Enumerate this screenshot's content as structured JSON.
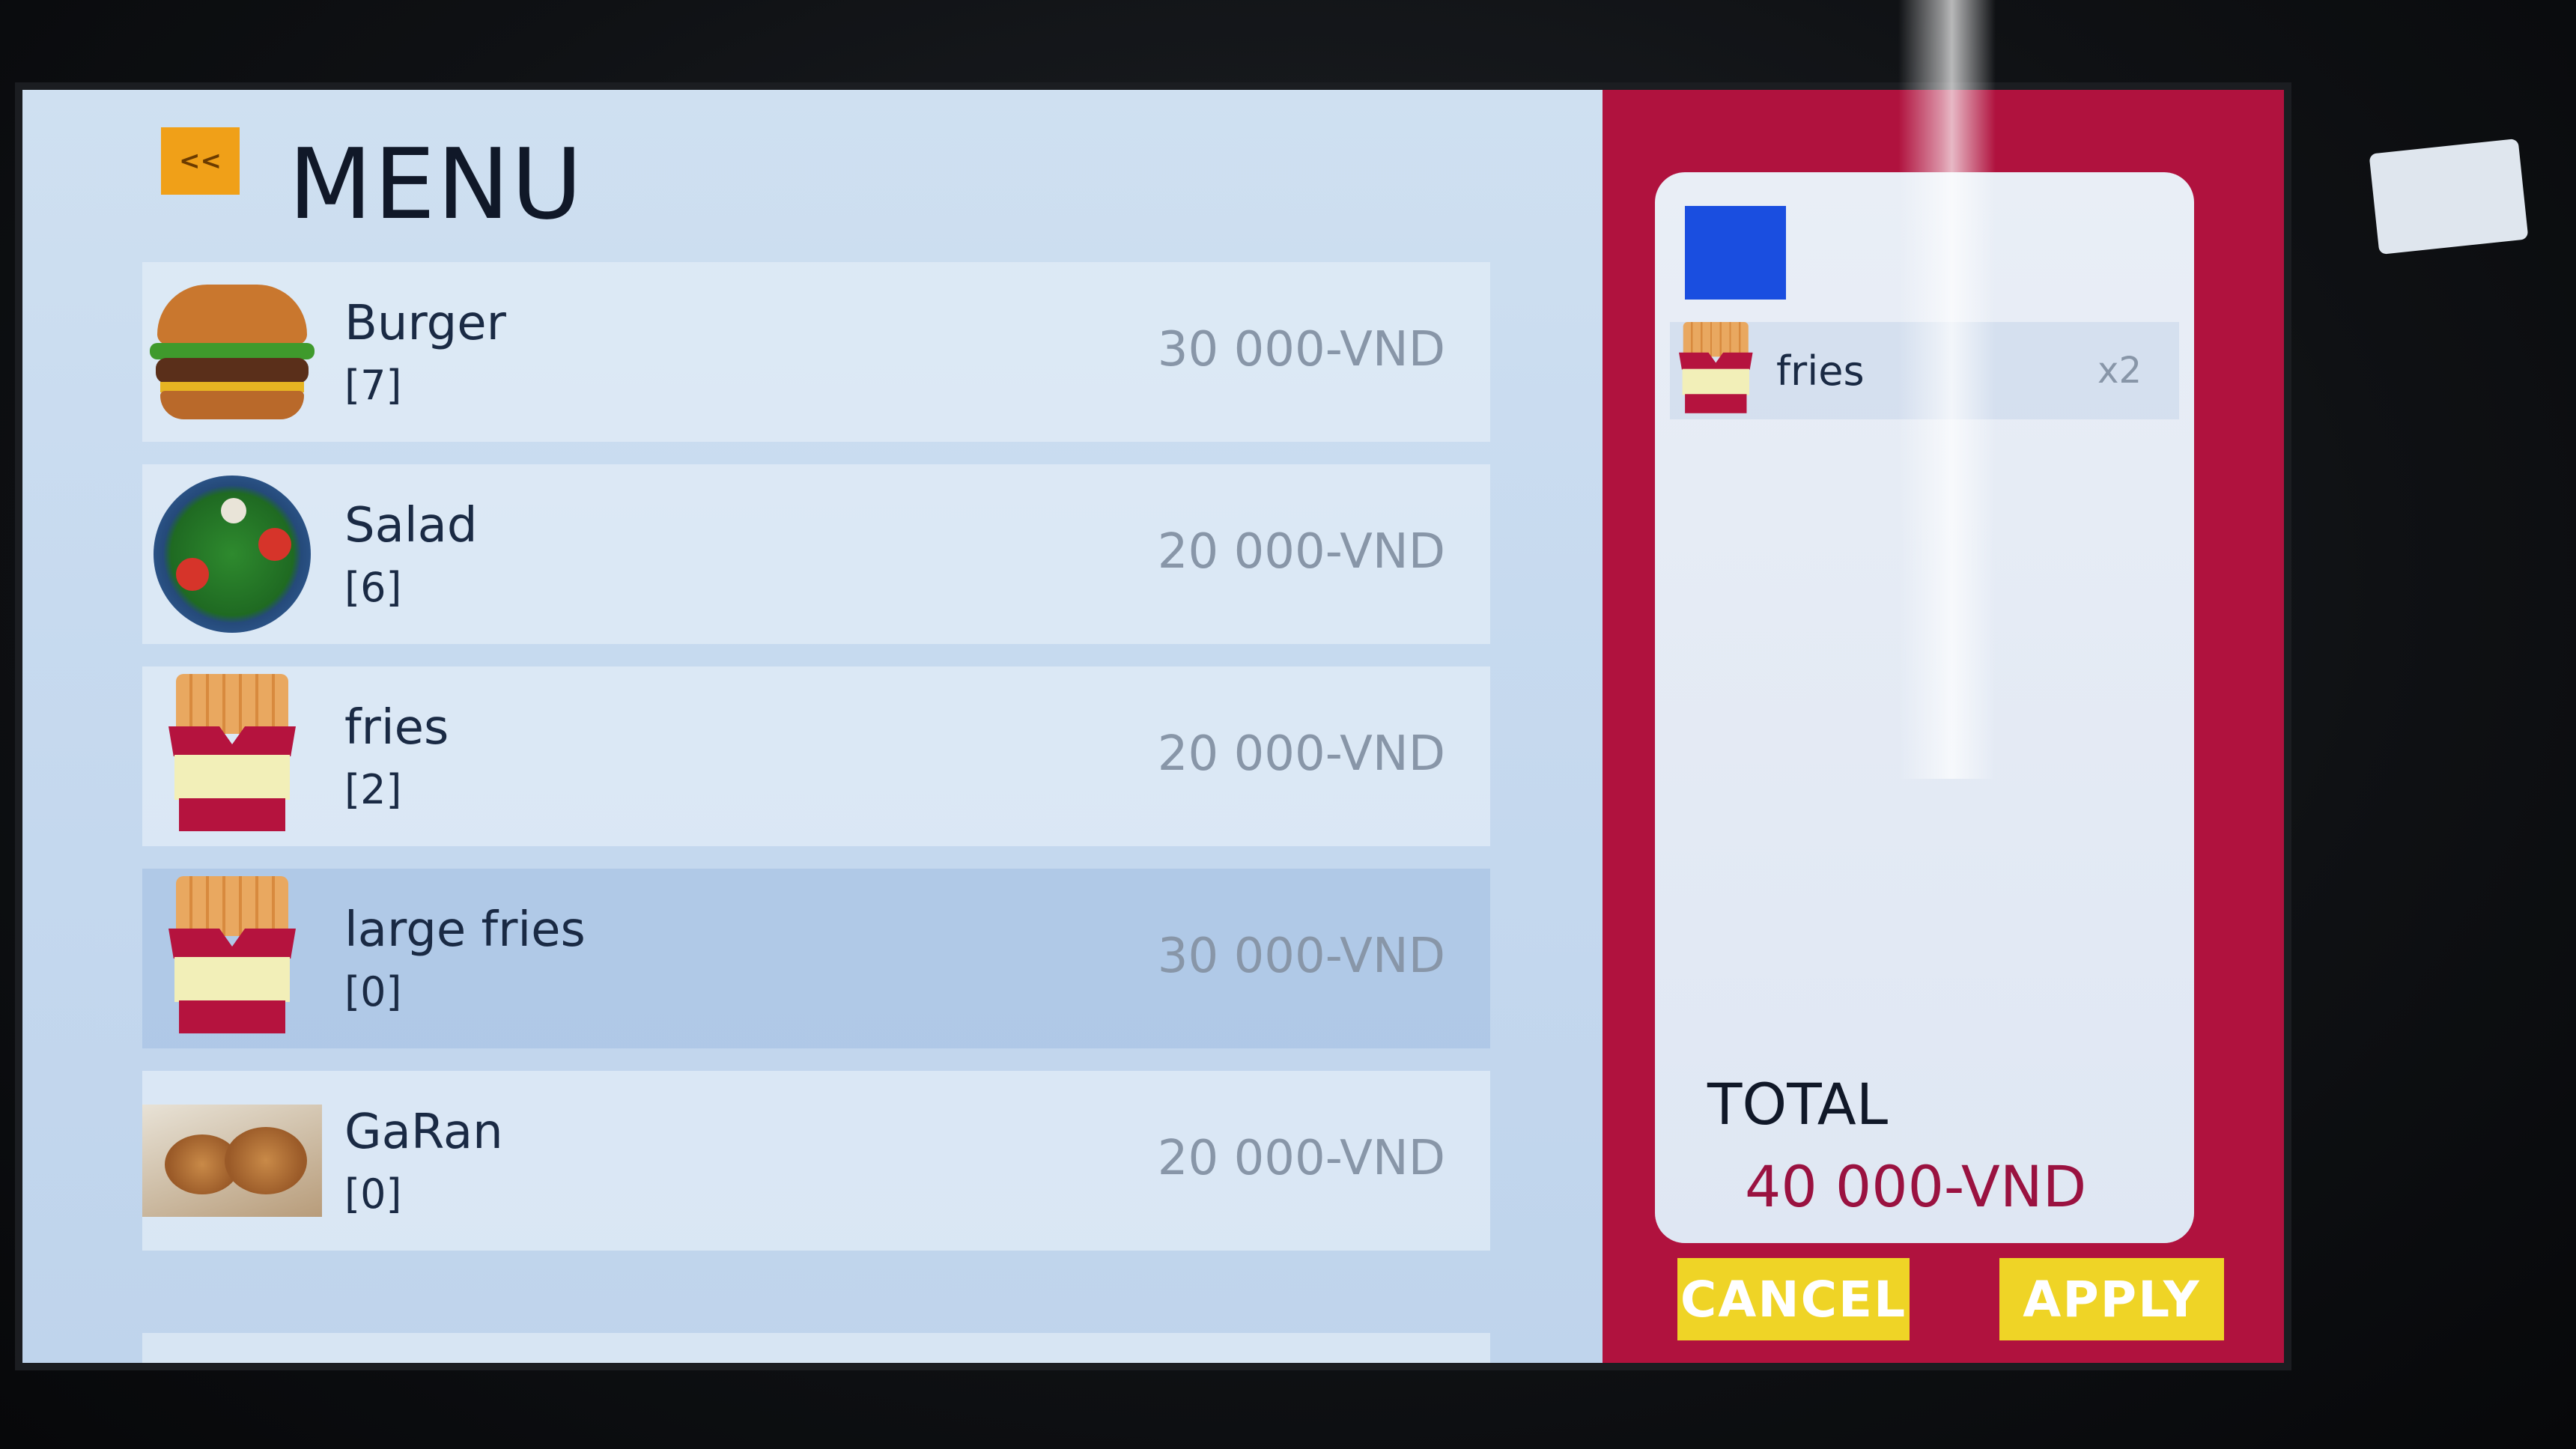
{
  "header": {
    "back_label": "<<",
    "title": "MENU"
  },
  "menu": {
    "items": [
      {
        "name": "Burger",
        "count": "[7]",
        "price": "30 000-VND",
        "icon": "burger-icon"
      },
      {
        "name": "Salad",
        "count": "[6]",
        "price": "20 000-VND",
        "icon": "salad-icon"
      },
      {
        "name": "fries",
        "count": "[2]",
        "price": "20 000-VND",
        "icon": "fries-icon"
      },
      {
        "name": "large fries",
        "count": "[0]",
        "price": "30 000-VND",
        "icon": "large-fries-icon"
      },
      {
        "name": "GaRan",
        "count": "[0]",
        "price": "20 000-VND",
        "icon": "fried-chicken-icon"
      }
    ]
  },
  "cart": {
    "items": [
      {
        "name": "fries",
        "qty": "x2",
        "icon": "fries-icon"
      }
    ],
    "total_label": "TOTAL",
    "total_value": "40 000-VND",
    "cancel_label": "CANCEL",
    "apply_label": "APPLY"
  },
  "colors": {
    "accent_orange": "#f0a018",
    "panel_red": "#b0123e",
    "button_yellow": "#efd426",
    "swatch_blue": "#1a4ee0"
  }
}
